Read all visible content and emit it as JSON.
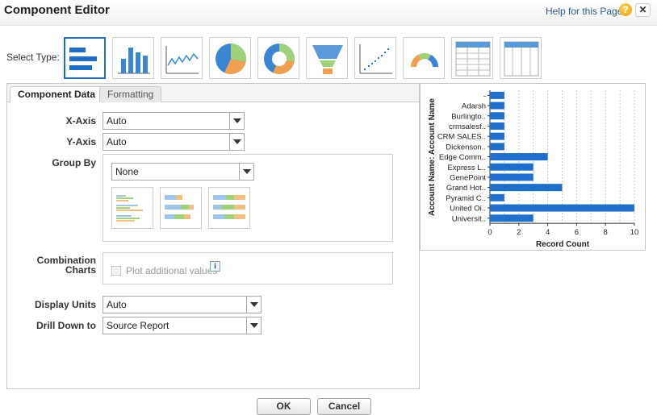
{
  "header": {
    "title": "Component Editor",
    "help_link": "Help for this Page",
    "help_icon": "?",
    "close": "✕"
  },
  "select_type": {
    "label": "Select Type:",
    "types": [
      {
        "name": "horizontal-bar-chart",
        "selected": true
      },
      {
        "name": "vertical-column-chart",
        "selected": false
      },
      {
        "name": "line-chart",
        "selected": false
      },
      {
        "name": "pie-chart",
        "selected": false
      },
      {
        "name": "donut-chart",
        "selected": false
      },
      {
        "name": "funnel-chart",
        "selected": false
      },
      {
        "name": "scatter-chart",
        "selected": false
      },
      {
        "name": "gauge-chart",
        "selected": false
      },
      {
        "name": "table-grid",
        "selected": false
      },
      {
        "name": "table-columns",
        "selected": false
      }
    ]
  },
  "tabs": [
    {
      "label": "Component Data",
      "active": true
    },
    {
      "label": "Formatting",
      "active": false
    }
  ],
  "form": {
    "x_axis": {
      "label": "X-Axis",
      "value": "Auto"
    },
    "y_axis": {
      "label": "Y-Axis",
      "value": "Auto"
    },
    "group_by": {
      "label": "Group By",
      "value": "None"
    },
    "combination": {
      "label_line1": "Combination",
      "label_line2": "Charts",
      "checkbox_label": "Plot additional values",
      "info_icon": "i"
    },
    "display_units": {
      "label": "Display Units",
      "value": "Auto"
    },
    "drill_down": {
      "label": "Drill Down to",
      "value": "Source Report"
    }
  },
  "buttons": {
    "ok": "OK",
    "cancel": "Cancel"
  },
  "colors": {
    "accent": "#1e6ec8",
    "bar": "#1f6fcc",
    "pie_green": "#9fd07a",
    "pie_orange": "#f0a050",
    "funnel_blue": "#5a9ad8"
  },
  "chart_data": {
    "type": "bar",
    "orientation": "horizontal",
    "categories": [
      "-",
      "Adarsh",
      "Burlingto..",
      "crmsalesf..",
      "CRM SALES..",
      "Dickenson..",
      "Edge Comm..",
      "Express L..",
      "GenePoint",
      "Grand Hot..",
      "Pyramid C..",
      "United Oi..",
      "Universit.."
    ],
    "values": [
      1,
      1,
      1,
      1,
      1,
      1,
      4,
      3,
      3,
      5,
      1,
      10,
      3
    ],
    "xlabel": "Record Count",
    "ylabel": "Account Name: Account Name",
    "xlim": [
      0,
      10
    ],
    "xticks": [
      "0",
      "2",
      "4",
      "6",
      "8",
      "10"
    ],
    "grid": true
  }
}
